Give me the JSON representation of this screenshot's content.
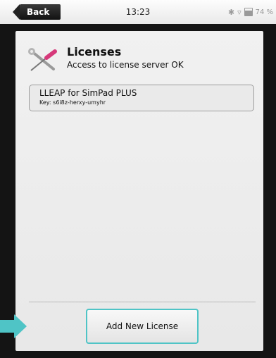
{
  "status_bar": {
    "back_label": "Back",
    "time": "13:23",
    "battery": "74 %",
    "icons": [
      "bluetooth-icon",
      "wifi-icon",
      "battery-icon"
    ]
  },
  "header": {
    "icon": "wrench-screwdriver-icon",
    "title": "Licenses",
    "subtitle": "Access to license server OK"
  },
  "licenses": [
    {
      "name": "LLEAP for SimPad PLUS",
      "key": "Key: s6i8z-herxy-umyhr"
    }
  ],
  "actions": {
    "add_label": "Add New License"
  },
  "colors": {
    "accent": "#4fc4c6",
    "bezel": "#141414",
    "panel": "#ececec"
  }
}
